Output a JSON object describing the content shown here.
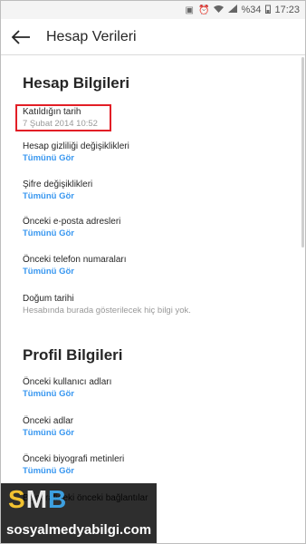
{
  "status": {
    "battery": "%34",
    "time": "17:23"
  },
  "header": {
    "title": "Hesap Verileri"
  },
  "account_section": {
    "title": "Hesap Bilgileri",
    "items": [
      {
        "label": "Katıldığın tarih",
        "value": "7 Şubat 2014 10:52"
      },
      {
        "label": "Hesap gizliliği değişiklikleri",
        "link": "Tümünü Gör"
      },
      {
        "label": "Şifre değişiklikleri",
        "link": "Tümünü Gör"
      },
      {
        "label": "Önceki e-posta adresleri",
        "link": "Tümünü Gör"
      },
      {
        "label": "Önceki telefon numaraları",
        "link": "Tümünü Gör"
      },
      {
        "label": "Doğum tarihi",
        "value": "Hesabında burada gösterilecek hiç bilgi yok."
      }
    ]
  },
  "profile_section": {
    "title": "Profil Bilgileri",
    "items": [
      {
        "label": "Önceki kullanıcı adları",
        "link": "Tümünü Gör"
      },
      {
        "label": "Önceki adlar",
        "link": "Tümünü Gör"
      },
      {
        "label": "Önceki biyografi metinleri",
        "link": "Tümünü Gör"
      },
      {
        "label": "Biyografideki önceki bağlantılar"
      }
    ]
  },
  "watermark": {
    "logo_s": "S",
    "logo_m": "M",
    "logo_b": "B",
    "url": "sosyalmedyabilgi.com"
  },
  "colors": {
    "link": "#3897f0",
    "highlight": "#e21e26"
  }
}
